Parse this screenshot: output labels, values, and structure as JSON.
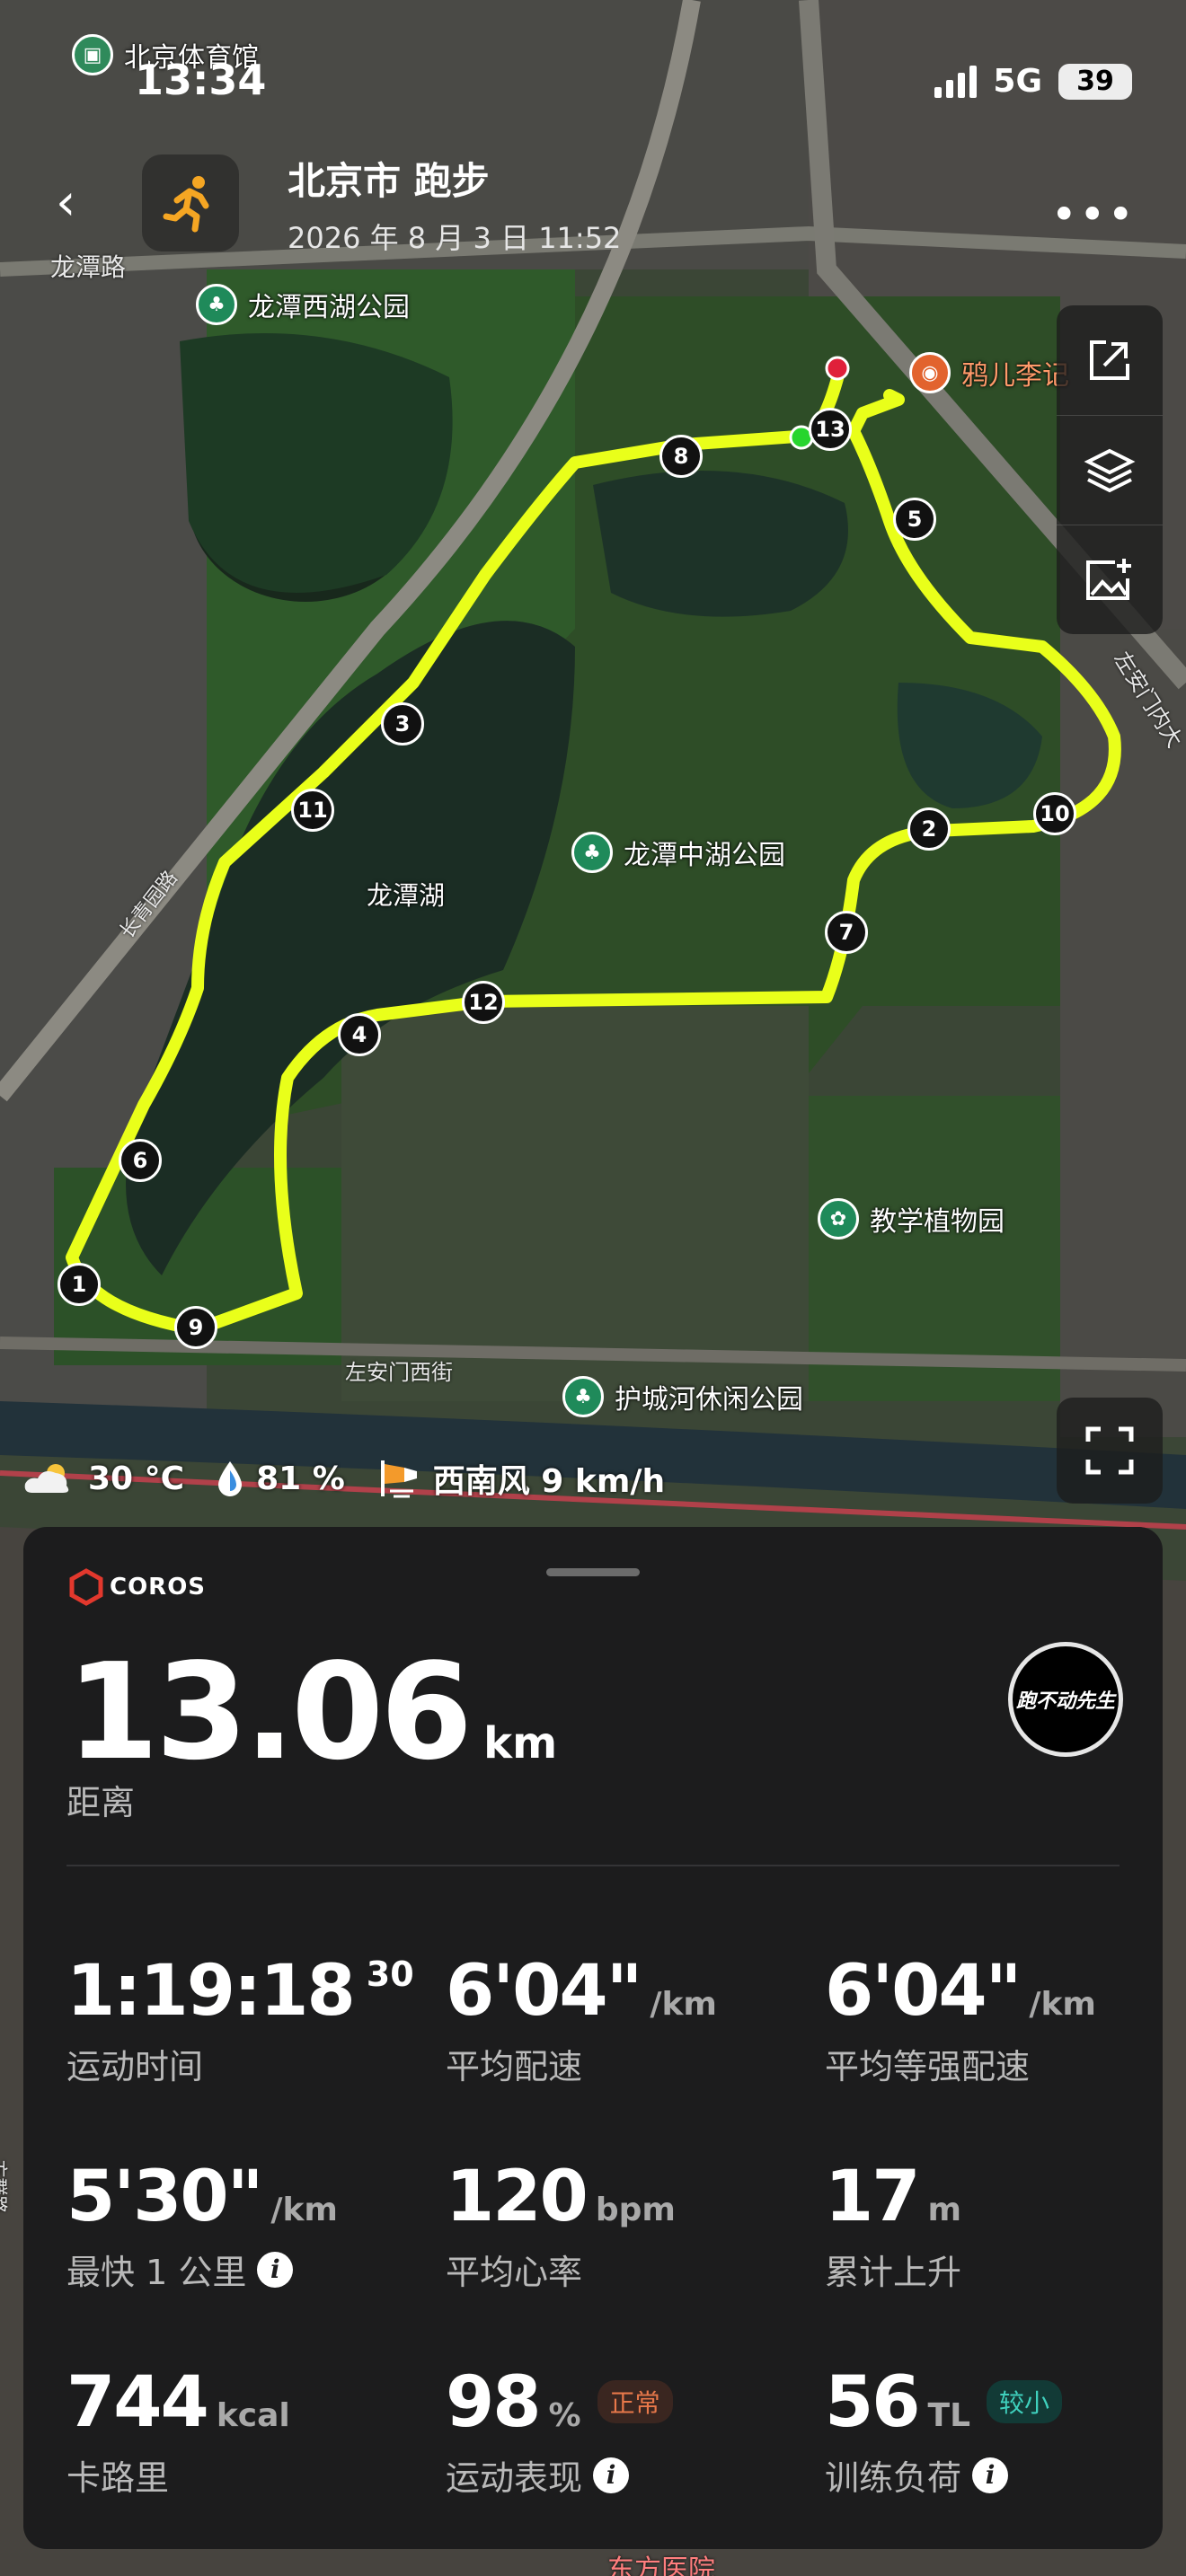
{
  "status_bar": {
    "time": "13:34",
    "network": "5G",
    "battery": "39"
  },
  "header": {
    "title": "北京市 跑步",
    "datetime": "2026 年 8 月 3 日 11:52"
  },
  "map": {
    "place_labels": {
      "stadium": "北京体育馆",
      "road_longtan": "龙潭路",
      "park_west": "龙潭西湖公园",
      "restaurant": "鸦儿李记",
      "lake": "龙潭湖",
      "park_middle": "龙潭中湖公园",
      "road_changqing": "长青园路",
      "botanic": "教学植物园",
      "road_zuoanmen_west": "左安门西街",
      "moat_park": "护城河休闲公园",
      "road_zuoanmen_inner": "左安门内大",
      "road_fangqun": "方群路",
      "hospital": "东方医院"
    },
    "route_color": "#e9ff1a",
    "markers": [
      "1",
      "2",
      "3",
      "4",
      "5",
      "6",
      "7",
      "8",
      "9",
      "10",
      "11",
      "12",
      "13"
    ]
  },
  "weather": {
    "temp": "30 °C",
    "humidity": "81 %",
    "wind": "西南风 9 km/h"
  },
  "panel": {
    "brand": "COROS",
    "distance": {
      "value": "13.06",
      "unit": "km",
      "label": "距离"
    },
    "avatar_text": "跑不动先生",
    "stats": [
      {
        "value": "1:19:18",
        "sup": "30",
        "unit": "",
        "label": "运动时间",
        "info": false
      },
      {
        "value": "6'04\"",
        "unit": "/km",
        "label": "平均配速",
        "info": false
      },
      {
        "value": "6'04\"",
        "unit": "/km",
        "label": "平均等强配速",
        "info": false
      },
      {
        "value": "5'30\"",
        "unit": "/km",
        "label": "最快 1 公里",
        "info": true
      },
      {
        "value": "120",
        "unit": "bpm",
        "label": "平均心率",
        "info": false
      },
      {
        "value": "17",
        "unit": "m",
        "label": "累计上升",
        "info": false
      },
      {
        "value": "744",
        "unit": "kcal",
        "label": "卡路里",
        "info": false
      },
      {
        "value": "98",
        "unit": "%",
        "tag": "正常",
        "label": "运动表现",
        "info": true
      },
      {
        "value": "56",
        "unit": "TL",
        "tag": "较小",
        "label": "训练负荷",
        "info": true
      }
    ]
  }
}
